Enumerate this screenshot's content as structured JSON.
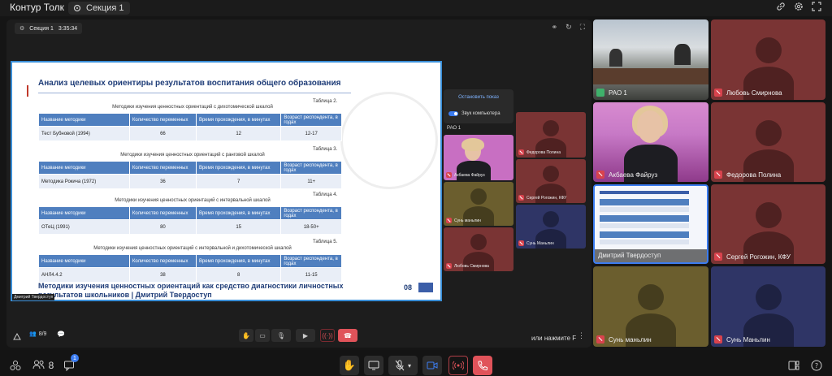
{
  "app": {
    "title": "Контур Толк",
    "section": "Секция 1"
  },
  "share": {
    "section_label": "Секция 1",
    "timer": "3:35:34",
    "speaker_tag": "Дмитрий Твердоступ"
  },
  "slide": {
    "title": "Анализ целевых ориентиры результатов воспитания общего образования",
    "tables": [
      {
        "num": "Таблица 2.",
        "caption": "Методики изучения ценностных ориентаций с дихотомической шкалой",
        "headers": [
          "Название методики",
          "Количество переменных",
          "Время прохождения, в минутах",
          "Возраст респондента, в годах"
        ],
        "row": [
          "Тест Бубновой (1994)",
          "66",
          "12",
          "12-17"
        ]
      },
      {
        "num": "Таблица 3.",
        "caption": "Методики изучения ценностных ориентаций с ранговой шкалой",
        "headers": [
          "Название методики",
          "Количество переменных",
          "Время прохождения, в минутах",
          "Возраст респондента, в годах"
        ],
        "row": [
          "Методика Рокича (1972)",
          "36",
          "7",
          "11+"
        ]
      },
      {
        "num": "Таблица 4.",
        "caption": "Методики изучения ценностных ориентаций с интервальной шкалой",
        "headers": [
          "Название методики",
          "Количество переменных",
          "Время прохождения, в минутах",
          "Возраст респондента, в годах"
        ],
        "row": [
          "ОТеЦ (1991)",
          "80",
          "15",
          "18-50+"
        ]
      },
      {
        "num": "Таблица 5.",
        "caption": "Методики изучения ценностных ориентаций с интервальной и дихотомической шкалой",
        "headers": [
          "Название методики",
          "Количество переменных",
          "Время прохождения, в минутах",
          "Возраст респондента, в годах"
        ],
        "row": [
          "АНЛ4.4.2",
          "38",
          "8",
          "11-15"
        ]
      }
    ],
    "footer": "Методики изучения ценностных ориентаций как средство диагностики личностных результатов школьников | Дмитрий Твердоступ",
    "page": "08"
  },
  "popup": {
    "stop": "Остановить показ",
    "sound": "Звук компьютера",
    "source": "РАО 1"
  },
  "small_tiles": [
    {
      "name": "Акбаева Файруз"
    },
    {
      "name": "Федорова Полина"
    },
    {
      "name": "Сергей Рогожин, КФУ"
    },
    {
      "name": "Сунь маньлин"
    },
    {
      "name": "Сунь Маньлин"
    },
    {
      "name": "Любовь Смирнова"
    }
  ],
  "inner_controls": {
    "participants": "8/9",
    "hint": "или нажмите F"
  },
  "grid": [
    {
      "name": "РАО 1"
    },
    {
      "name": "Любовь Смирнова"
    },
    {
      "name": "Акбаева Файруз"
    },
    {
      "name": "Федорова Полина"
    },
    {
      "name": "Дмитрий Твердоступ"
    },
    {
      "name": "Сергей Рогожин, КФУ"
    },
    {
      "name": "Сунь маньлин"
    },
    {
      "name": "Сунь Маньлин"
    }
  ],
  "bottom": {
    "participants_count": "8",
    "chat_badge": "1"
  },
  "colors": {
    "accent": "#3b7cf0",
    "end_call": "#e0535a",
    "tile_red": "#7a3434",
    "tile_olive": "#6b5e2e",
    "tile_navy": "#2f3566"
  }
}
